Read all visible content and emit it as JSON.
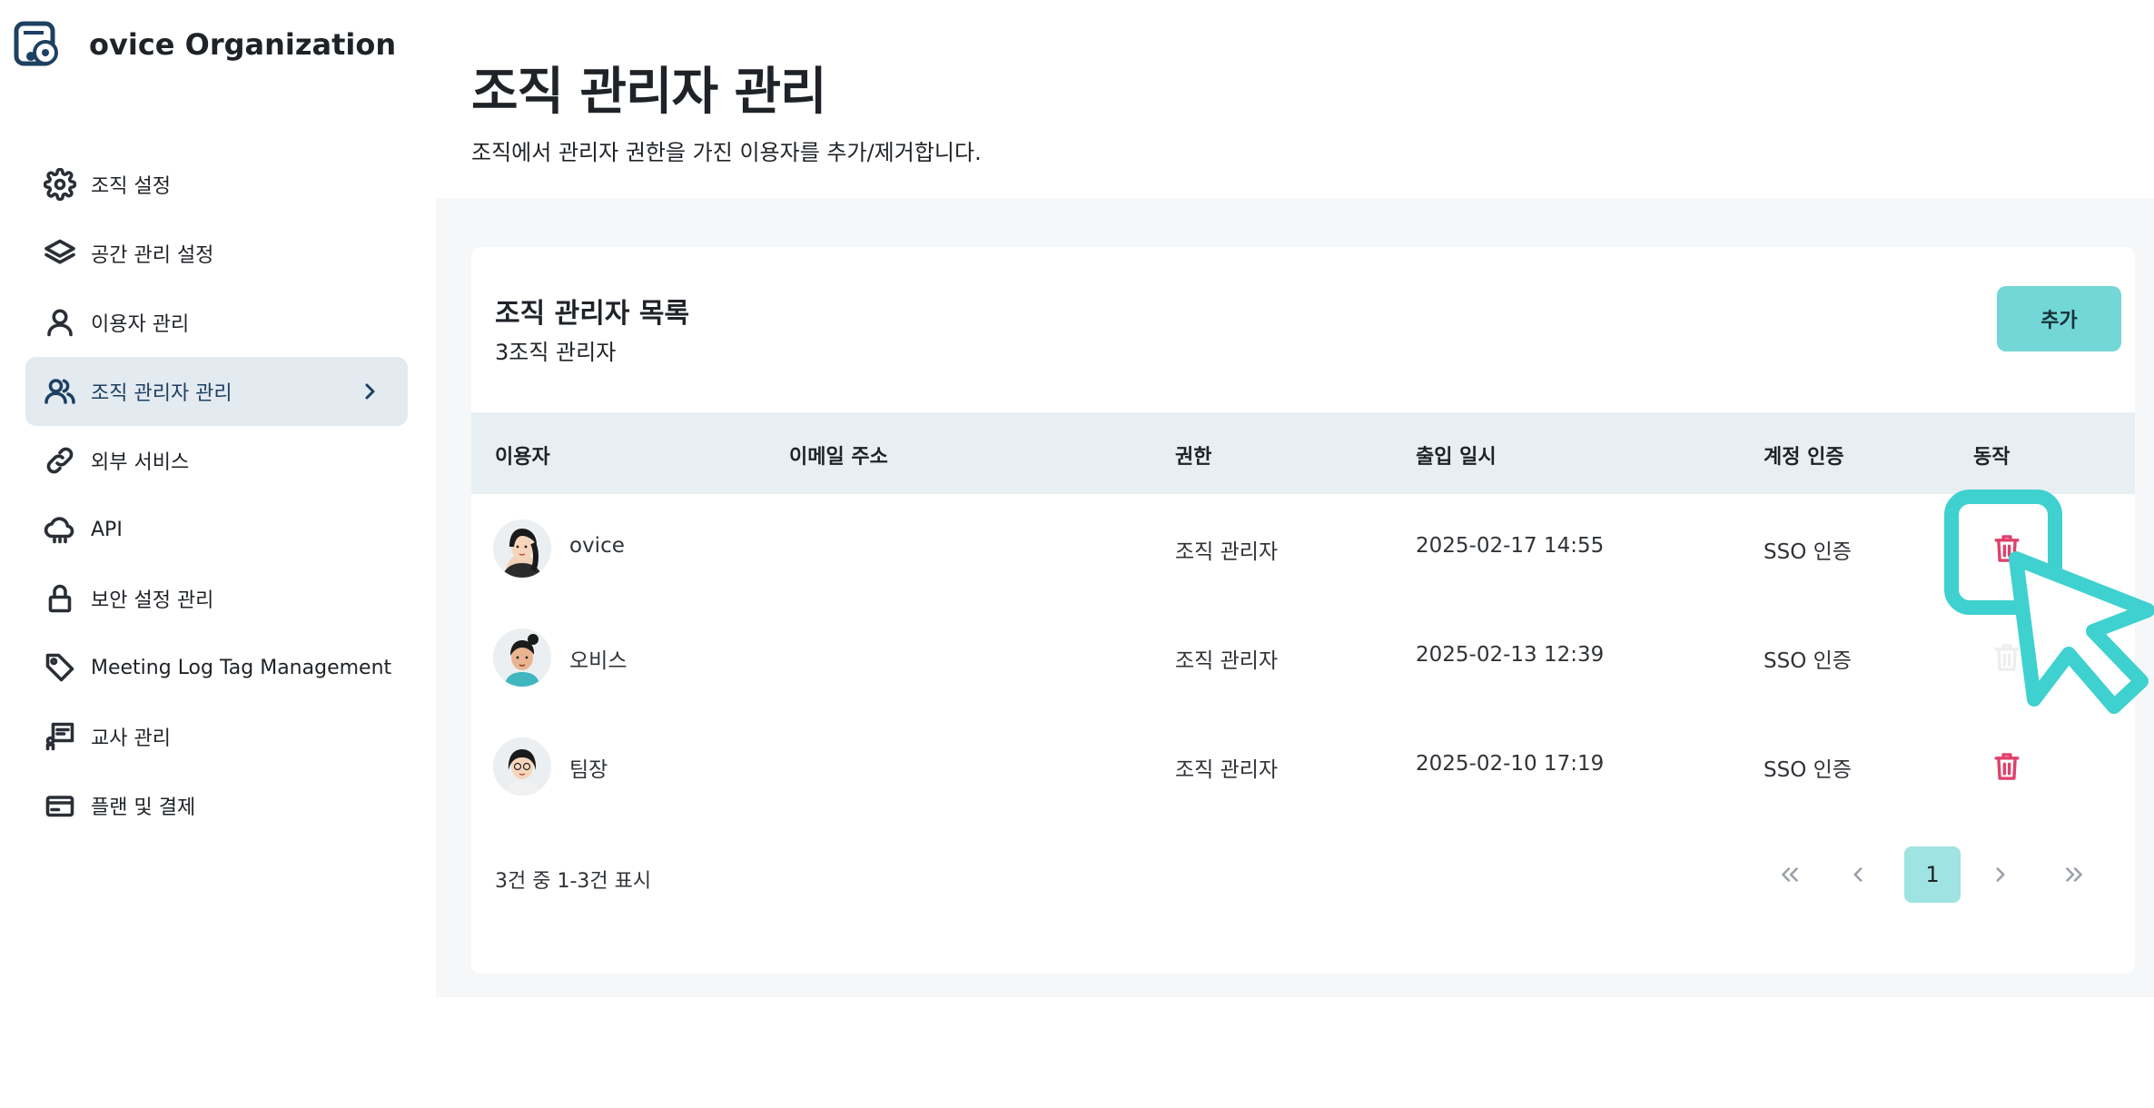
{
  "app": {
    "org_name": "ovice Organization"
  },
  "sidebar": {
    "items": [
      {
        "label": "조직 설정",
        "icon": "gear-icon"
      },
      {
        "label": "공간 관리 설정",
        "icon": "layers-icon"
      },
      {
        "label": "이용자 관리",
        "icon": "user-icon"
      },
      {
        "label": "조직 관리자 관리",
        "icon": "users-icon",
        "active": true
      },
      {
        "label": "외부 서비스",
        "icon": "link-icon"
      },
      {
        "label": "API",
        "icon": "cloud-icon"
      },
      {
        "label": "보안 설정 관리",
        "icon": "lock-icon"
      },
      {
        "label": "Meeting Log Tag Management",
        "icon": "tag-icon"
      },
      {
        "label": "교사 관리",
        "icon": "teacher-icon"
      },
      {
        "label": "플랜 및 결제",
        "icon": "credit-card-icon"
      }
    ]
  },
  "header": {
    "title": "조직 관리자 관리",
    "description": "조직에서 관리자 권한을 가진 이용자를 추가/제거합니다."
  },
  "card": {
    "title": "조직 관리자 목록",
    "subtitle": "3조직 관리자",
    "add_label": "추가"
  },
  "table": {
    "columns": [
      "이용자",
      "이메일 주소",
      "권한",
      "출입 일시",
      "계정 인증",
      "동작"
    ],
    "rows": [
      {
        "name": "ovice",
        "email": "",
        "role": "조직 관리자",
        "datetime": "2025-02-17 14:55",
        "auth": "SSO 인증"
      },
      {
        "name": "오비스",
        "email": "",
        "role": "조직 관리자",
        "datetime": "2025-02-13 12:39",
        "auth": "SSO 인증"
      },
      {
        "name": "팀장",
        "email": "",
        "role": "조직 관리자",
        "datetime": "2025-02-10 17:19",
        "auth": "SSO 인증"
      }
    ]
  },
  "pagination": {
    "info": "3건 중 1-3건 표시",
    "current_page": "1"
  },
  "colors": {
    "accent": "#72d7d6",
    "highlight": "#3ed1cf",
    "delete": "#e0406a",
    "active_nav_bg": "#e3eaf0",
    "table_header_bg": "#e8eff2"
  }
}
